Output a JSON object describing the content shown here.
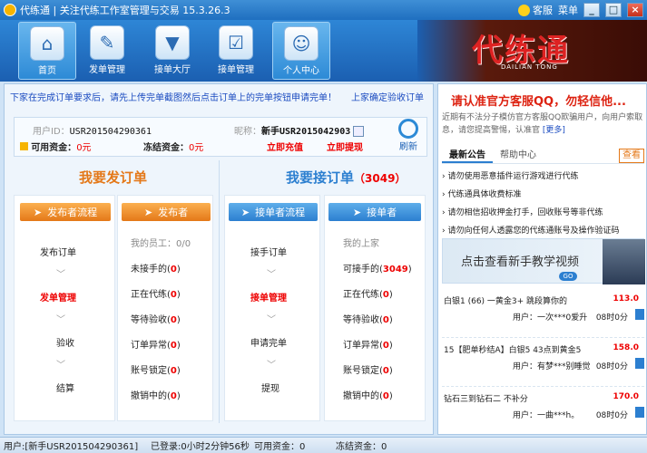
{
  "window": {
    "title": "代练通 | 关注代练工作室管理与交易 15.3.26.3",
    "service_label": "客服",
    "menu_label": "菜单",
    "min": "_",
    "max": "□",
    "close": "×"
  },
  "nav": {
    "items": [
      {
        "label": "首页",
        "icon": "⌂"
      },
      {
        "label": "发单管理",
        "icon": "✎"
      },
      {
        "label": "接单大厅",
        "icon": "▼"
      },
      {
        "label": "接单管理",
        "icon": "☑"
      },
      {
        "label": "个人中心",
        "icon": "☺"
      }
    ],
    "banner_title": "代练通",
    "banner_sub": "DAILIAN TONG"
  },
  "main": {
    "notice": "下家在完成订单要求后，请先上传完单截图然后点击订单上的完单按钮申请完单！",
    "notice_link": "上家确定验收订单",
    "user": {
      "user_id_label": "用户ID：",
      "user_id": "USR201504290361",
      "alias_label": "昵称：",
      "alias": "新手USR2015042903",
      "avail_label": "可用资金：",
      "avail": "0元",
      "frozen_label": "冻结资金：",
      "frozen": "0元",
      "recharge": "立即充值",
      "withdraw": "立即提现",
      "refresh": "刷新"
    },
    "left_title": "我要发订单",
    "right_title": "我要接订单",
    "right_count": "（3049）",
    "pub_flow": {
      "header": "发布者流程",
      "steps": [
        "发布订单",
        "发单管理",
        "验收",
        "结算"
      ]
    },
    "pub": {
      "header": "发布者",
      "staff": "我的员工：0/0",
      "rows": [
        {
          "label": "未接手的",
          "count": "0"
        },
        {
          "label": "正在代练",
          "count": "0"
        },
        {
          "label": "等待验收",
          "count": "0"
        },
        {
          "label": "订单异常",
          "count": "0"
        },
        {
          "label": "账号锁定",
          "count": "0"
        },
        {
          "label": "撤销中的",
          "count": "0"
        }
      ]
    },
    "take_flow": {
      "header": "接单者流程",
      "steps": [
        "接手订单",
        "接单管理",
        "申请完单",
        "提现"
      ]
    },
    "take": {
      "header": "接单者",
      "boss": "我的上家",
      "rows": [
        {
          "label": "可接手的",
          "count": "3049"
        },
        {
          "label": "正在代练",
          "count": "0"
        },
        {
          "label": "等待验收",
          "count": "0"
        },
        {
          "label": "订单异常",
          "count": "0"
        },
        {
          "label": "账号锁定",
          "count": "0"
        },
        {
          "label": "撤销中的",
          "count": "0"
        }
      ]
    }
  },
  "right": {
    "warning": "请认准官方客服QQ，勿轻信他...",
    "sub1": "近期有不法分子模仿官方客服QQ欺骗用户，向用户索取",
    "sub2": "息，请您提高警惕，认准官",
    "sub_more": "[更多]",
    "tabs": [
      "最新公告",
      "帮助中心"
    ],
    "tab_more": "查看",
    "announcements": [
      "请勿使用恶意插件运行游戏进行代练",
      "代练通具体收费标准",
      "请勿相信招收押金打手，回收账号等非代练",
      "请勿向任何人透露您的代练通账号及操作验证码"
    ],
    "promo": "点击查看新手教学视频",
    "promo_go": "GO",
    "orders": [
      {
        "title": "白银1 (66) 一黄金3+ 跳段算你的",
        "price": "113.0",
        "user": "用户：一次***0爱升",
        "hours": "08时0分"
      },
      {
        "title": "15【肥单秒结A】白银5 43点到黄金5",
        "price": "158.0",
        "user": "用户：有梦***别睡觉",
        "hours": "08时0分"
      },
      {
        "title": "钻石三到钻石二 不补分",
        "price": "170.0",
        "user": "用户：一曲***h。",
        "hours": "08时0分"
      }
    ]
  },
  "status": {
    "user": "用户:[新手USR201504290361]",
    "login": "已登录:0小时2分钟56秒",
    "avail": "可用资金：0",
    "frozen": "冻结资金：0"
  }
}
